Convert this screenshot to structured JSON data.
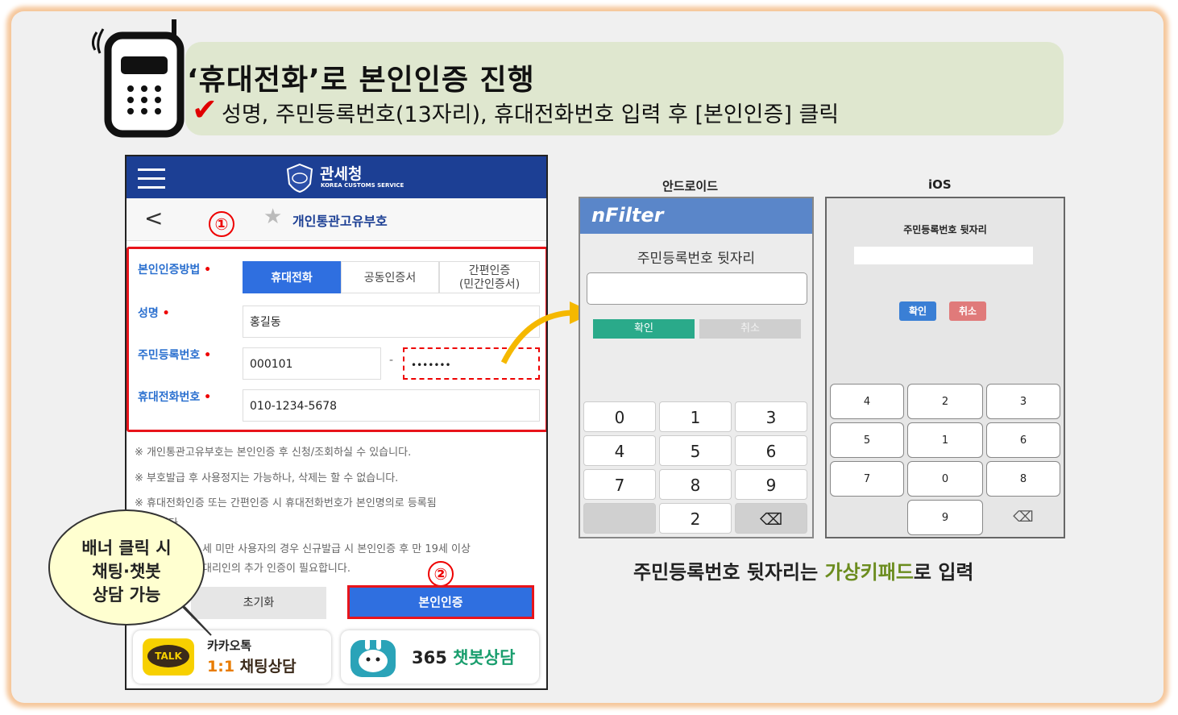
{
  "banner": {
    "title": "‘휴대전화’로  본인인증  진행",
    "subtitle": "성명, 주민등록번호(13자리), 휴대전화번호  입력 후 [본인인증]  클릭",
    "check_icon": "check-icon"
  },
  "app": {
    "brand_name": "관세청",
    "brand_eng": "KOREA CUSTOMS SERVICE",
    "page_title": "개인통관고유부호",
    "back_glyph": "<",
    "star_glyph": "★"
  },
  "markers": {
    "one": "①",
    "two": "②"
  },
  "form": {
    "method_label": "본인인증방법",
    "methods": [
      "휴대전화",
      "공동인증서",
      "간편인증\n(민간인증서)"
    ],
    "method_selected": "휴대전화",
    "name_label": "성명",
    "name_value": "홍길동",
    "rrn_label": "주민등록번호",
    "rrn_front": "000101",
    "rrn_dash": "-",
    "rrn_back": "•••••••",
    "phone_label": "휴대전화번호",
    "phone_value": "010-1234-5678",
    "required_mark": "•"
  },
  "notes": [
    "※  개인통관고유부호는 본인인증 후 신청/조회하실 수 있습니다.",
    "※  부호발급 후 사용정지는 가능하나, 삭제는 할 수 없습니다.",
    "※  휴대전화인증 또는 간편인증 시 휴대전화번호가 본인명의로 등록됨",
    "니다.",
    "세 미만 사용자의 경우 신규발급 시 본인인증 후 만 19세 이상",
    "대리인의 추가 인증이 필요합니다."
  ],
  "buttons": {
    "reset": "초기화",
    "auth": "본인인증"
  },
  "kakao": {
    "badge": "TALK",
    "line1": "카카오톡",
    "line2_ratio": "1:1",
    "line2_text": "채팅상담"
  },
  "chatbot": {
    "number": "365",
    "text": "챗봇상담"
  },
  "bubble": {
    "lines": [
      "배너 클릭 시",
      "채팅·챗봇",
      "상담 가능"
    ]
  },
  "android": {
    "platform": "안드로이드",
    "brand": "nFilter",
    "prompt": "주민등록번호 뒷자리",
    "ok": "확인",
    "cancel": "취소",
    "keys": [
      "0",
      "1",
      "3",
      "4",
      "5",
      "6",
      "7",
      "8",
      "9",
      "",
      "2",
      "⌫"
    ]
  },
  "ios": {
    "platform": "iOS",
    "prompt": "주민등록번호 뒷자리",
    "ok": "확인",
    "cancel": "취소",
    "keys": [
      "4",
      "2",
      "3",
      "5",
      "1",
      "6",
      "7",
      "0",
      "8",
      "",
      "9",
      "⌫"
    ]
  },
  "caption": {
    "pre": "주민등록번호 뒷자리는 ",
    "highlight": "가상키패드",
    "post": "로 입력"
  }
}
